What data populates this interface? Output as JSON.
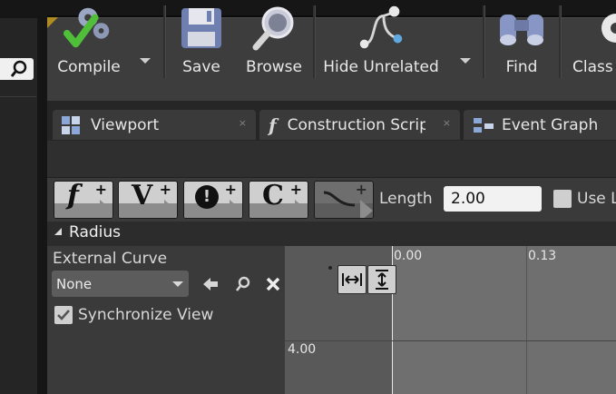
{
  "toolbar": {
    "compile_label": "Compile",
    "save_label": "Save",
    "browse_label": "Browse",
    "hide_unrelated_label": "Hide Unrelated",
    "find_label": "Find",
    "class_label": "Class"
  },
  "tabs": [
    {
      "label": "Viewport",
      "close": "×"
    },
    {
      "label": "Construction Script",
      "close": "×"
    },
    {
      "label": "Event Graph"
    }
  ],
  "timeline": {
    "key_buttons": [
      "f",
      "V",
      "!",
      "C"
    ],
    "length_label": "Length",
    "length_value": "2.00",
    "use_label": "Use L"
  },
  "radius": {
    "title": "Radius",
    "external_curve_label": "External Curve",
    "external_curve_value": "None",
    "sync_label": "Synchronize View",
    "sync_checked": true
  },
  "graph": {
    "x_labels": [
      "0.00",
      "0.13"
    ],
    "y_labels": [
      "4.00"
    ]
  },
  "colors": {
    "toolbar_bg": "#3d3d3d",
    "accent_corner": "#b08a22",
    "graph_bg": "#595959"
  }
}
